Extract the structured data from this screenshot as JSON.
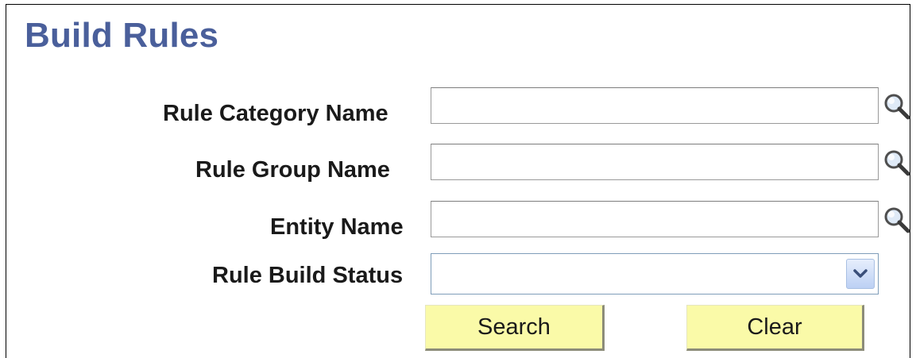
{
  "page": {
    "title": "Build Rules"
  },
  "form": {
    "rule_category": {
      "label": "Rule Category Name",
      "value": ""
    },
    "rule_group": {
      "label": "Rule Group Name",
      "value": ""
    },
    "entity": {
      "label": "Entity Name",
      "value": ""
    },
    "build_status": {
      "label": "Rule Build Status",
      "value": ""
    }
  },
  "actions": {
    "search_label": "Search",
    "clear_label": "Clear"
  },
  "icons": {
    "lookup": "magnifier-icon",
    "dropdown": "chevron-down-icon"
  },
  "colors": {
    "title": "#4a5f9b",
    "button_bg": "#fafaa8",
    "lookup_lens": "#7fa6d6",
    "dropdown_arrow": "#3a4f7a"
  }
}
